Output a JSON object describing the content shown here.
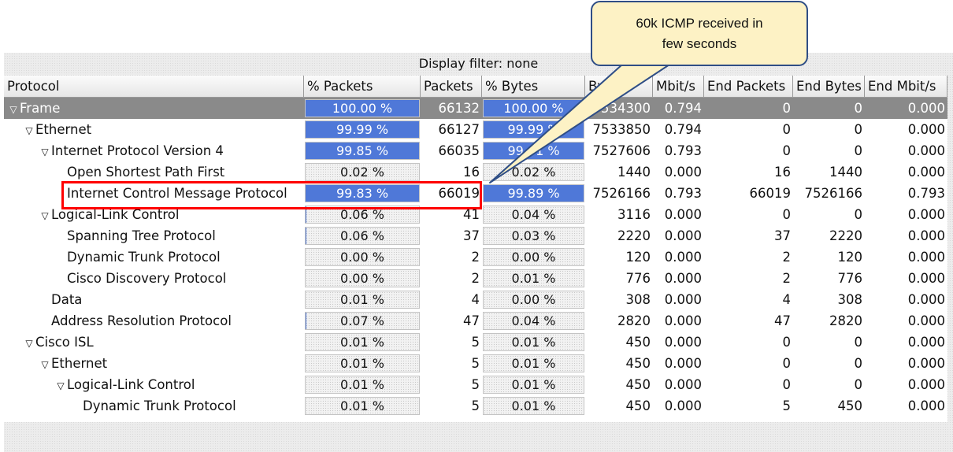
{
  "filter_label": "Display filter: none",
  "columns": [
    "Protocol",
    "% Packets",
    "Packets",
    "% Bytes",
    "Bytes",
    "Mbit/s",
    "End Packets",
    "End Bytes",
    "End Mbit/s"
  ],
  "rows": [
    {
      "name": "Frame",
      "level": 0,
      "expander": true,
      "selected": true,
      "pct_packets": "100.00 %",
      "pct_packets_value": 100.0,
      "packets": "66132",
      "pct_bytes": "100.00 %",
      "pct_bytes_value": 100.0,
      "bytes": "7534300",
      "mbit": "0.794",
      "end_packets": "0",
      "end_bytes": "0",
      "end_mbit": "0.000"
    },
    {
      "name": "Ethernet",
      "level": 1,
      "expander": true,
      "pct_packets": "99.99 %",
      "pct_packets_value": 99.99,
      "packets": "66127",
      "pct_bytes": "99.99 %",
      "pct_bytes_value": 99.99,
      "bytes": "7533850",
      "mbit": "0.794",
      "end_packets": "0",
      "end_bytes": "0",
      "end_mbit": "0.000"
    },
    {
      "name": "Internet Protocol Version 4",
      "level": 2,
      "expander": true,
      "pct_packets": "99.85 %",
      "pct_packets_value": 99.85,
      "packets": "66035",
      "pct_bytes": "99.91 %",
      "pct_bytes_value": 99.91,
      "bytes": "7527606",
      "mbit": "0.793",
      "end_packets": "0",
      "end_bytes": "0",
      "end_mbit": "0.000"
    },
    {
      "name": "Open Shortest Path First",
      "level": 3,
      "expander": false,
      "pct_packets": "0.02 %",
      "pct_packets_value": 0.02,
      "packets": "16",
      "pct_bytes": "0.02 %",
      "pct_bytes_value": 0.02,
      "bytes": "1440",
      "mbit": "0.000",
      "end_packets": "16",
      "end_bytes": "1440",
      "end_mbit": "0.000"
    },
    {
      "name": "Internet Control Message Protocol",
      "level": 3,
      "expander": false,
      "pct_packets": "99.83 %",
      "pct_packets_value": 99.83,
      "packets": "66019",
      "pct_bytes": "99.89 %",
      "pct_bytes_value": 99.89,
      "bytes": "7526166",
      "mbit": "0.793",
      "end_packets": "66019",
      "end_bytes": "7526166",
      "end_mbit": "0.793"
    },
    {
      "name": "Logical-Link Control",
      "level": 2,
      "expander": true,
      "pct_packets": "0.06 %",
      "pct_packets_value": 0.06,
      "packets": "41",
      "pct_bytes": "0.04 %",
      "pct_bytes_value": 0.04,
      "bytes": "3116",
      "mbit": "0.000",
      "end_packets": "0",
      "end_bytes": "0",
      "end_mbit": "0.000"
    },
    {
      "name": "Spanning Tree Protocol",
      "level": 3,
      "expander": false,
      "pct_packets": "0.06 %",
      "pct_packets_value": 0.06,
      "packets": "37",
      "pct_bytes": "0.03 %",
      "pct_bytes_value": 0.03,
      "bytes": "2220",
      "mbit": "0.000",
      "end_packets": "37",
      "end_bytes": "2220",
      "end_mbit": "0.000"
    },
    {
      "name": "Dynamic Trunk Protocol",
      "level": 3,
      "expander": false,
      "pct_packets": "0.00 %",
      "pct_packets_value": 0.0,
      "packets": "2",
      "pct_bytes": "0.00 %",
      "pct_bytes_value": 0.0,
      "bytes": "120",
      "mbit": "0.000",
      "end_packets": "2",
      "end_bytes": "120",
      "end_mbit": "0.000"
    },
    {
      "name": "Cisco Discovery Protocol",
      "level": 3,
      "expander": false,
      "pct_packets": "0.00 %",
      "pct_packets_value": 0.0,
      "packets": "2",
      "pct_bytes": "0.01 %",
      "pct_bytes_value": 0.01,
      "bytes": "776",
      "mbit": "0.000",
      "end_packets": "2",
      "end_bytes": "776",
      "end_mbit": "0.000"
    },
    {
      "name": "Data",
      "level": 2,
      "expander": false,
      "pct_packets": "0.01 %",
      "pct_packets_value": 0.01,
      "packets": "4",
      "pct_bytes": "0.00 %",
      "pct_bytes_value": 0.0,
      "bytes": "308",
      "mbit": "0.000",
      "end_packets": "4",
      "end_bytes": "308",
      "end_mbit": "0.000"
    },
    {
      "name": "Address Resolution Protocol",
      "level": 2,
      "expander": false,
      "pct_packets": "0.07 %",
      "pct_packets_value": 0.07,
      "packets": "47",
      "pct_bytes": "0.04 %",
      "pct_bytes_value": 0.04,
      "bytes": "2820",
      "mbit": "0.000",
      "end_packets": "47",
      "end_bytes": "2820",
      "end_mbit": "0.000"
    },
    {
      "name": "Cisco ISL",
      "level": 1,
      "expander": true,
      "pct_packets": "0.01 %",
      "pct_packets_value": 0.01,
      "packets": "5",
      "pct_bytes": "0.01 %",
      "pct_bytes_value": 0.01,
      "bytes": "450",
      "mbit": "0.000",
      "end_packets": "0",
      "end_bytes": "0",
      "end_mbit": "0.000"
    },
    {
      "name": "Ethernet",
      "level": 2,
      "expander": true,
      "pct_packets": "0.01 %",
      "pct_packets_value": 0.01,
      "packets": "5",
      "pct_bytes": "0.01 %",
      "pct_bytes_value": 0.01,
      "bytes": "450",
      "mbit": "0.000",
      "end_packets": "0",
      "end_bytes": "0",
      "end_mbit": "0.000"
    },
    {
      "name": "Logical-Link Control",
      "level": 3,
      "expander": true,
      "pct_packets": "0.01 %",
      "pct_packets_value": 0.01,
      "packets": "5",
      "pct_bytes": "0.01 %",
      "pct_bytes_value": 0.01,
      "bytes": "450",
      "mbit": "0.000",
      "end_packets": "0",
      "end_bytes": "0",
      "end_mbit": "0.000"
    },
    {
      "name": "Dynamic Trunk Protocol",
      "level": 4,
      "expander": false,
      "pct_packets": "0.01 %",
      "pct_packets_value": 0.01,
      "packets": "5",
      "pct_bytes": "0.01 %",
      "pct_bytes_value": 0.01,
      "bytes": "450",
      "mbit": "0.000",
      "end_packets": "5",
      "end_bytes": "450",
      "end_mbit": "0.000"
    }
  ],
  "callout_text": "60k ICMP received in few seconds",
  "icons": {
    "expander": "triangle-down-icon"
  },
  "colors": {
    "bar_fill": "#4f78d8",
    "selected_row": "#8a8a8a",
    "highlight_box": "#ff0000",
    "callout_fill": "#fdf2c5",
    "callout_border": "#2f4e86"
  }
}
